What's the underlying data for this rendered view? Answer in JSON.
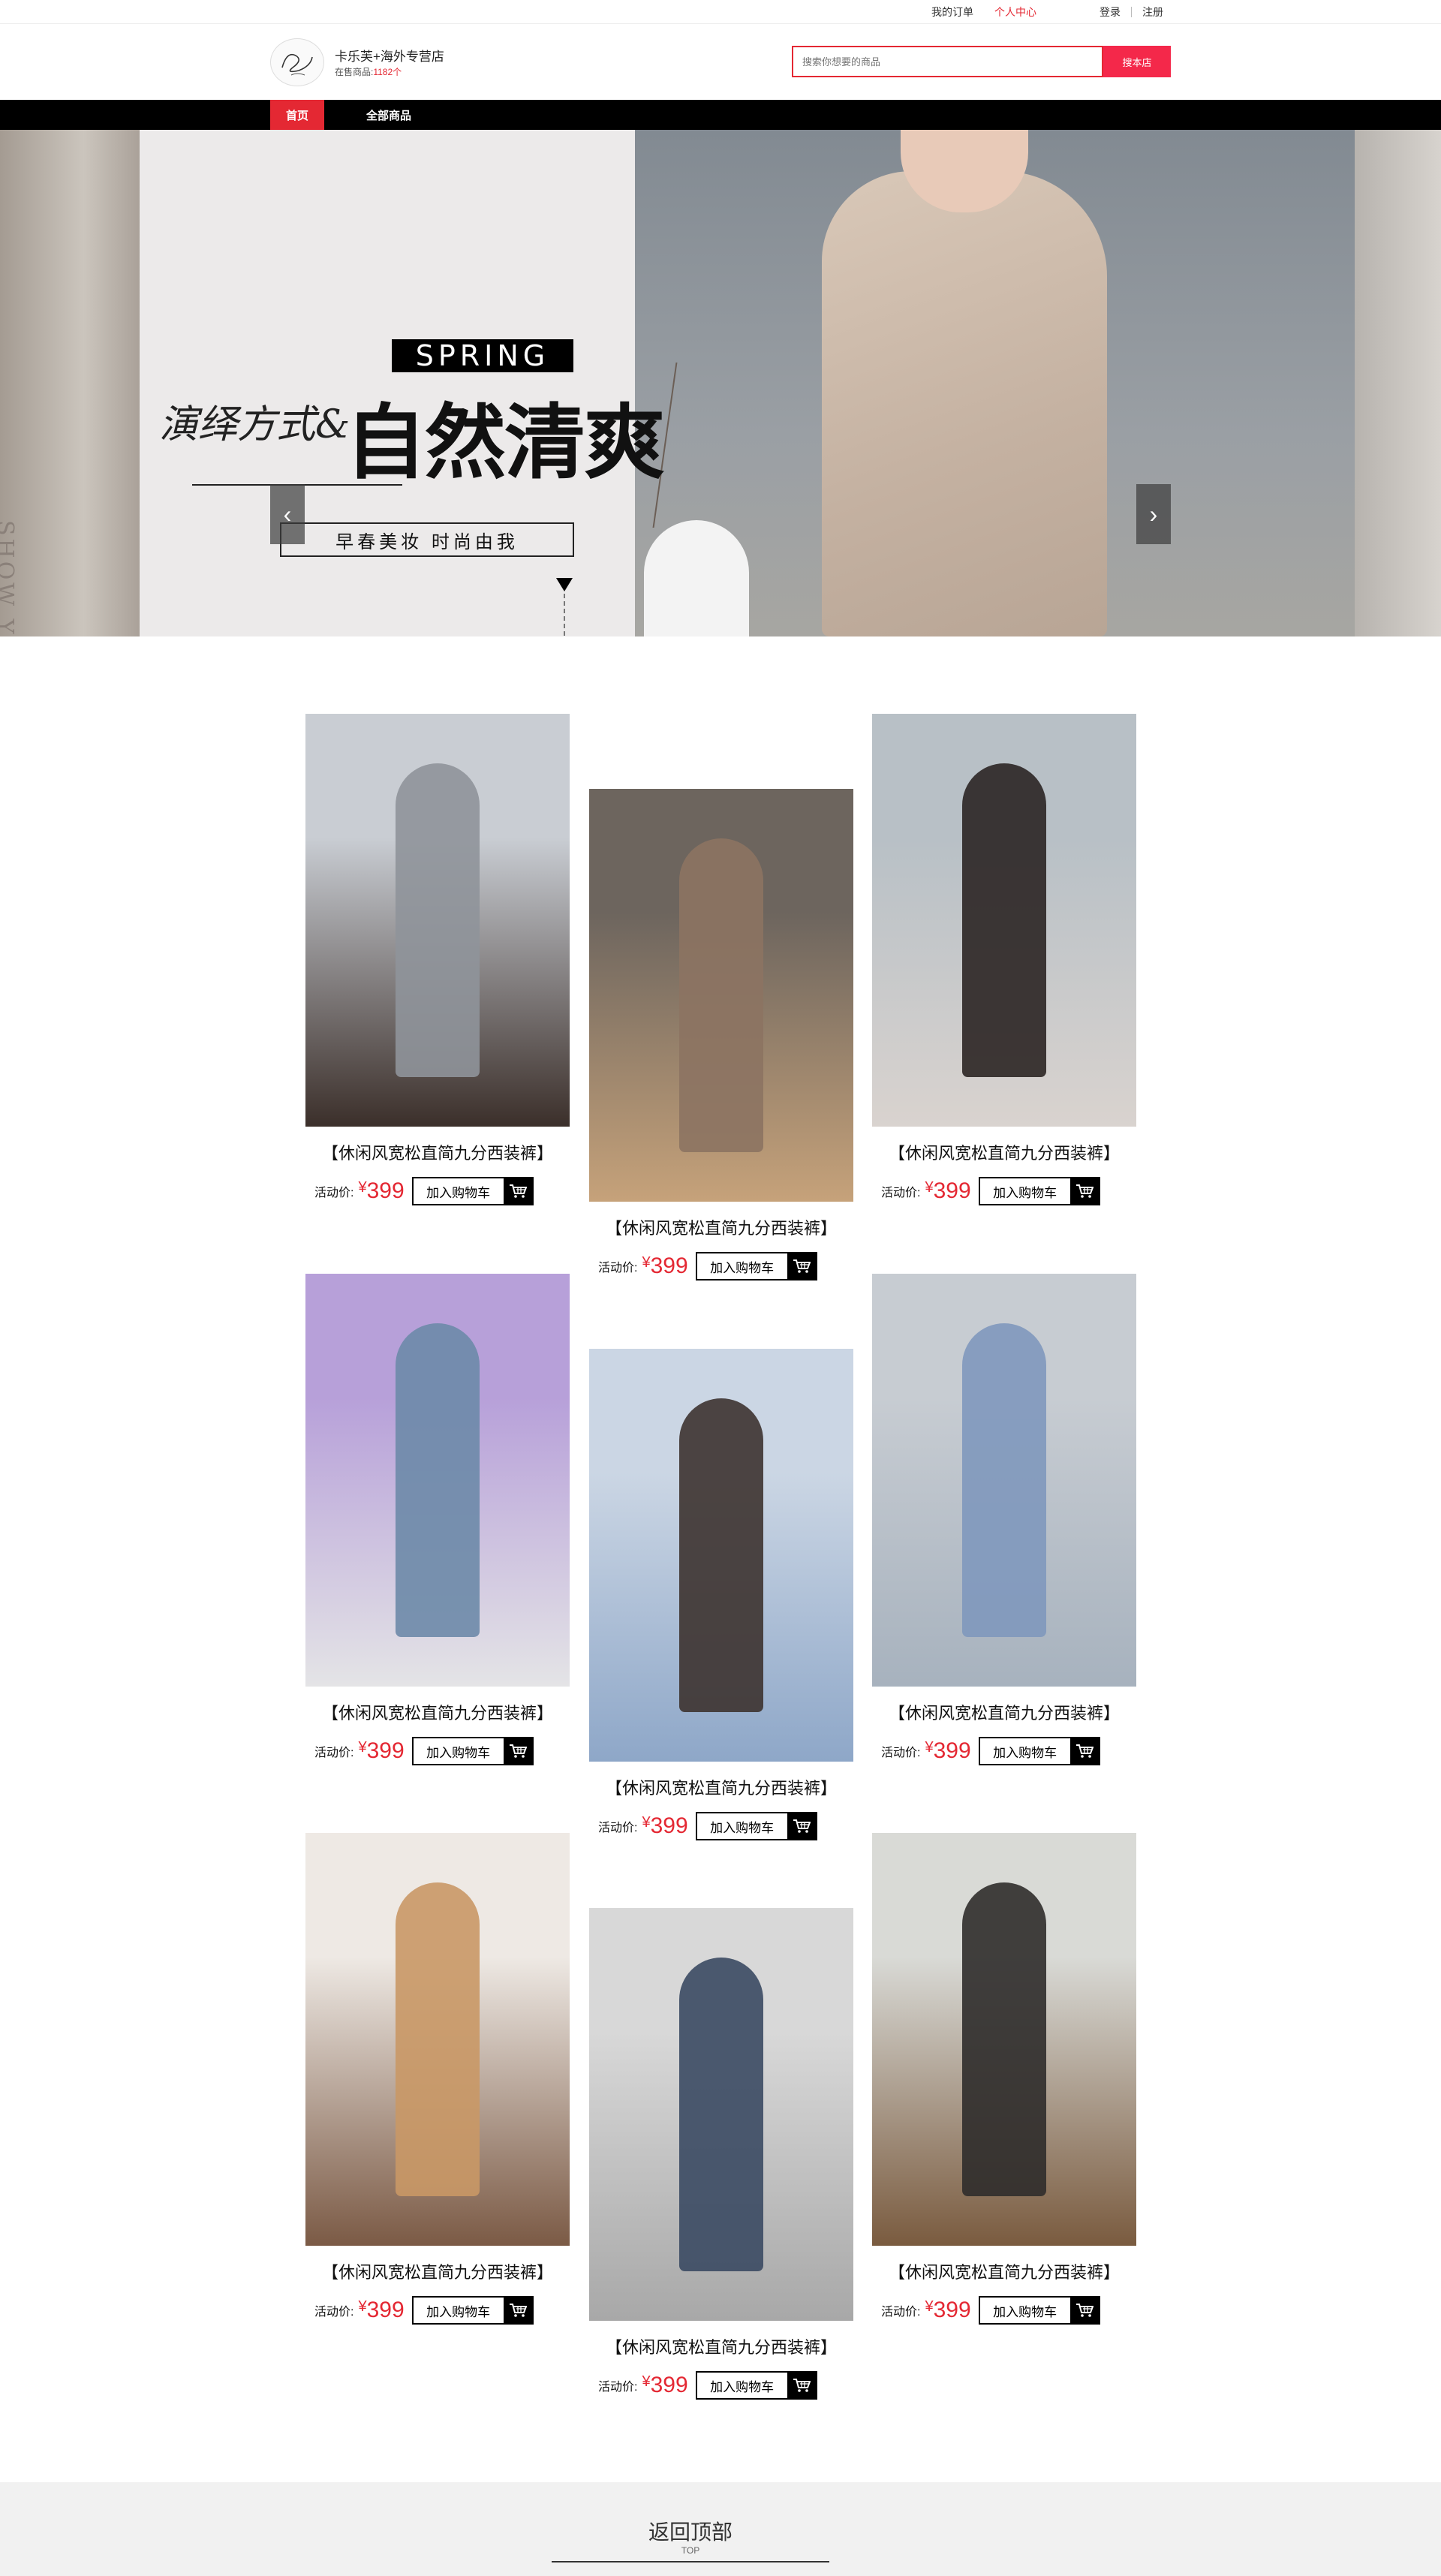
{
  "topbar": {
    "orders": "我的订单",
    "personal_center": "个人中心",
    "bell_icon": "bell-icon",
    "cart_icon": "cart-icon",
    "login": "登录",
    "register": "注册"
  },
  "header": {
    "store_name": "卡乐芙+海外专营店",
    "products_prefix": "在售商品:",
    "products_count": "1182个",
    "search_placeholder": "搜索你想要的商品",
    "search_button": "搜本店"
  },
  "nav": {
    "home": "首页",
    "all_products": "全部商品"
  },
  "banner": {
    "spring": "SPRING",
    "script": "演绎方式&",
    "title": "自然清爽",
    "subtitle": "早春美妆  时尚由我",
    "side_text": "SHOW YOU",
    "prev": "‹",
    "next": "›",
    "dot_count": 5,
    "active_dot": 0
  },
  "products": [
    {
      "name": "【休闲风宽松直简九分西装裤】",
      "price_label": "活动价:",
      "currency": "¥",
      "price": "399",
      "cart_label": "加入购物车",
      "palette": [
        "#c9cdd3",
        "#8f939a",
        "#3b2f2a"
      ]
    },
    {
      "name": "【休闲风宽松直简九分西装裤】",
      "price_label": "活动价:",
      "currency": "¥",
      "price": "399",
      "cart_label": "加入购物车",
      "palette": [
        "#6d655e",
        "#8c7362",
        "#c6a27a"
      ]
    },
    {
      "name": "【休闲风宽松直简九分西装裤】",
      "price_label": "活动价:",
      "currency": "¥",
      "price": "399",
      "cart_label": "加入购物车",
      "palette": [
        "#b8c0c6",
        "#2b2524",
        "#d9d3cf"
      ]
    },
    {
      "name": "【休闲风宽松直简九分西装裤】",
      "price_label": "活动价:",
      "currency": "¥",
      "price": "399",
      "cart_label": "加入购物车",
      "palette": [
        "#b7a0d9",
        "#6d89a8",
        "#e4e4e6"
      ]
    },
    {
      "name": "【休闲风宽松直简九分西装裤】",
      "price_label": "活动价:",
      "currency": "¥",
      "price": "399",
      "cart_label": "加入购物车",
      "palette": [
        "#cbd6e4",
        "#3d3330",
        "#8ea7c8"
      ]
    },
    {
      "name": "【休闲风宽松直简九分西装裤】",
      "price_label": "活动价:",
      "currency": "¥",
      "price": "399",
      "cart_label": "加入购物车",
      "palette": [
        "#c7ccd2",
        "#7f98bd",
        "#a7b2be"
      ]
    },
    {
      "name": "【休闲风宽松直简九分西装裤】",
      "price_label": "活动价:",
      "currency": "¥",
      "price": "399",
      "cart_label": "加入购物车",
      "palette": [
        "#eee9e4",
        "#c99866",
        "#7b5a45"
      ]
    },
    {
      "name": "【休闲风宽松直简九分西装裤】",
      "price_label": "活动价:",
      "currency": "¥",
      "price": "399",
      "cart_label": "加入购物车",
      "palette": [
        "#d8d8d8",
        "#3b4a63",
        "#a8a8a8"
      ]
    },
    {
      "name": "【休闲风宽松直简九分西装裤】",
      "price_label": "活动价:",
      "currency": "¥",
      "price": "399",
      "cart_label": "加入购物车",
      "palette": [
        "#d9dad6",
        "#2f2c2b",
        "#7a5b3f"
      ]
    }
  ],
  "footer": {
    "back_to_top": "返回顶部",
    "back_to_top_sub": "TOP"
  }
}
